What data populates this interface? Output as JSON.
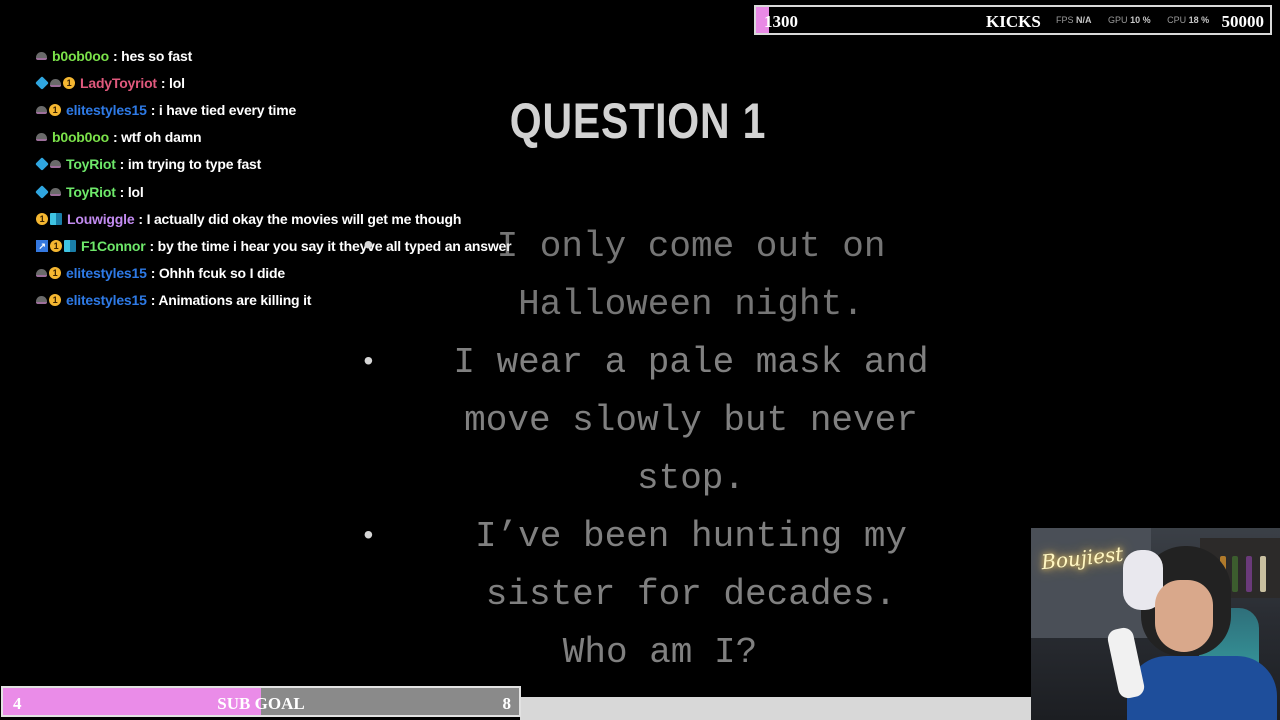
{
  "kicks_goal": {
    "current": "1300",
    "label": "KICKS",
    "target": "50000",
    "progress": 0.026
  },
  "perf_overlay": {
    "fps_label": "FPS",
    "fps_value": "N/A",
    "gpu_label": "GPU",
    "gpu_value": "10 %",
    "cpu_label": "CPU",
    "cpu_value": "18 %"
  },
  "chat": [
    {
      "badges": [
        "hat-icon"
      ],
      "user": "b0ob0oo",
      "color": "#7be14a",
      "message": ": hes so fast"
    },
    {
      "badges": [
        "cube-icon",
        "hat-icon",
        "coin-icon"
      ],
      "user": "LadyToyriot",
      "color": "#e0597d",
      "message": ": lol"
    },
    {
      "badges": [
        "hat-icon",
        "coin-icon"
      ],
      "user": "elitestyles15",
      "color": "#2e7ae6",
      "message": ": i have tied every time"
    },
    {
      "badges": [
        "hat-icon"
      ],
      "user": "b0ob0oo",
      "color": "#7be14a",
      "message": ": wtf oh damn"
    },
    {
      "badges": [
        "cube-icon",
        "hat-icon"
      ],
      "user": "ToyRiot",
      "color": "#6ee86a",
      "message": ": im trying to type fast"
    },
    {
      "badges": [
        "cube-icon",
        "hat-icon"
      ],
      "user": "ToyRiot",
      "color": "#6ee86a",
      "message": ": lol"
    },
    {
      "badges": [
        "coin-icon",
        "grid-icon"
      ],
      "user": "Louwiggle",
      "color": "#c28bf0",
      "message": ": I actually did okay the movies will get me though"
    },
    {
      "badges": [
        "arrow-icon",
        "coin-icon",
        "grid-icon"
      ],
      "user": "F1Connor",
      "color": "#6ee86a",
      "message": ": by the time i hear you say it theyve all typed an answer"
    },
    {
      "badges": [
        "hat-icon",
        "coin-icon"
      ],
      "user": "elitestyles15",
      "color": "#2e7ae6",
      "message": ": Ohhh fcuk so I dide"
    },
    {
      "badges": [
        "hat-icon",
        "coin-icon"
      ],
      "user": "elitestyles15",
      "color": "#2e7ae6",
      "message": ": Animations are killing it"
    }
  ],
  "question": {
    "title": "QUESTION 1",
    "clues": [
      "I only come out on Halloween night.",
      "I wear a pale mask and move slowly but never stop.",
      "I’ve been hunting my sister for decades."
    ],
    "ending": "Who am I?"
  },
  "sub_goal": {
    "current": "4",
    "label": "SUB GOAL",
    "target": "8",
    "progress": 0.5
  },
  "webcam": {
    "neon_sign": "Boujiest"
  }
}
